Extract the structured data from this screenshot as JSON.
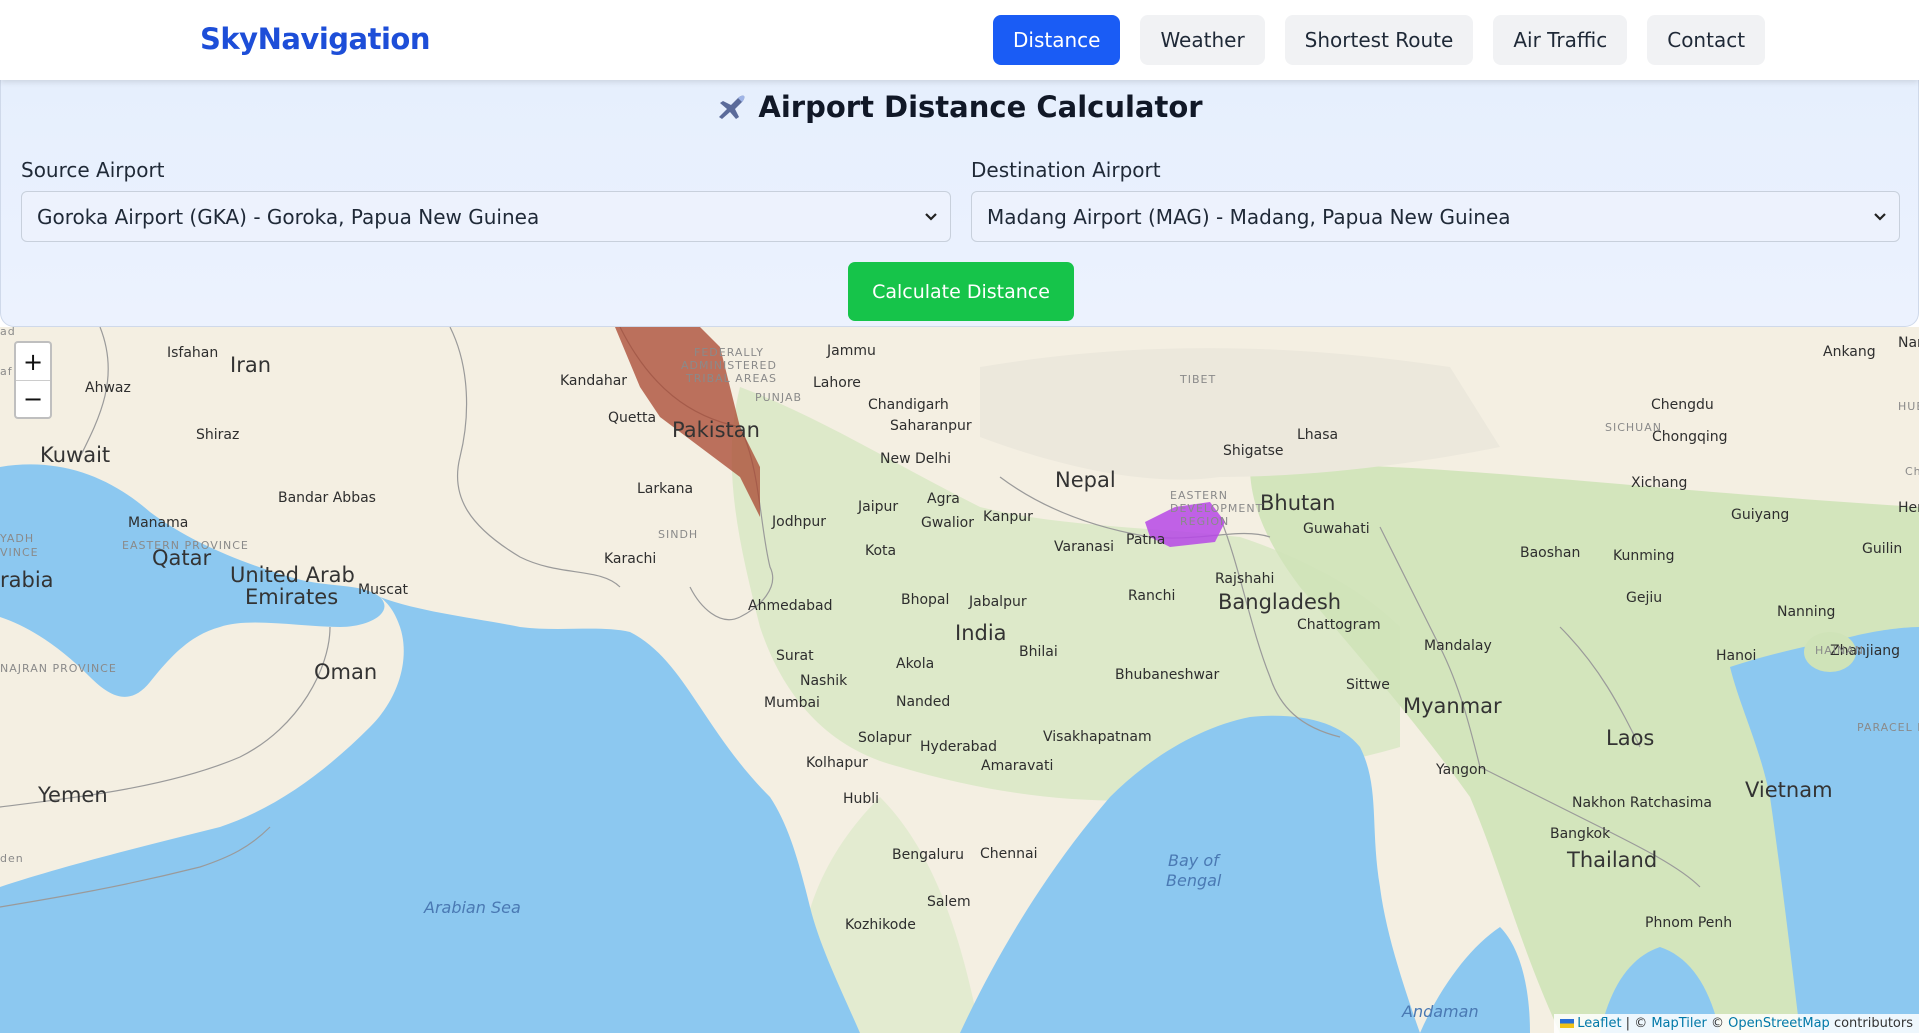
{
  "navbar": {
    "brand": "SkyNavigation",
    "links": [
      {
        "label": "Distance",
        "active": true
      },
      {
        "label": "Weather",
        "active": false
      },
      {
        "label": "Shortest Route",
        "active": false
      },
      {
        "label": "Air Traffic",
        "active": false
      },
      {
        "label": "Contact",
        "active": false
      }
    ]
  },
  "calculator": {
    "title": "Airport Distance Calculator",
    "title_icon": "airplane-icon",
    "source": {
      "label": "Source Airport",
      "value": "Goroka Airport (GKA) - Goroka, Papua New Guinea"
    },
    "destination": {
      "label": "Destination Airport",
      "value": "Madang Airport (MAG) - Madang, Papua New Guinea"
    },
    "button_label": "Calculate Distance"
  },
  "map": {
    "zoom_in": "+",
    "zoom_out": "−",
    "countries": [
      "Iran",
      "Pakistan",
      "Nepal",
      "Bhutan",
      "Bangladesh",
      "India",
      "Myanmar",
      "Laos",
      "Vietnam",
      "Thailand",
      "Oman",
      "Yemen",
      "Kuwait",
      "Qatar",
      "United Arab",
      "Emirates",
      "rabia"
    ],
    "cities": [
      "Isfahan",
      "Ahwaz",
      "Shiraz",
      "Bandar Abbas",
      "Manama",
      "Muscat",
      "Kandahar",
      "Quetta",
      "Jammu",
      "Lahore",
      "Chandigarh",
      "Saharanpur",
      "New Delhi",
      "Larkana",
      "Karachi",
      "Jaipur",
      "Agra",
      "Gwalior",
      "Jodhpur",
      "Kanpur",
      "Varanasi",
      "Patna",
      "Kota",
      "Bhopal",
      "Jabalpur",
      "Ranchi",
      "Ahmedabad",
      "Surat",
      "Nashik",
      "Mumbai",
      "Akola",
      "Bhilai",
      "Nanded",
      "Bhubaneshwar",
      "Solapur",
      "Hyderabad",
      "Visakhapatnam",
      "Kolhapur",
      "Amaravati",
      "Hubli",
      "Bengaluru",
      "Chennai",
      "Salem",
      "Kozhikode",
      "Shigatse",
      "Lhasa",
      "Guwahati",
      "Rajshahi",
      "Chattogram",
      "Sittwe",
      "Mandalay",
      "Yangon",
      "Chengdu",
      "Chongqing",
      "Ankang",
      "Xichang",
      "Guiyang",
      "Baoshan",
      "Kunming",
      "Guilin",
      "Gejiu",
      "Nanning",
      "Zhanjiang",
      "Hanoi",
      "Nakhon Ratchasima",
      "Bangkok",
      "Phnom Penh",
      "Nar",
      "Hen"
    ],
    "regions": [
      "FEDERALLY",
      "ADMINISTERED",
      "TRIBAL AREAS",
      "PUNJAB",
      "SINDH",
      "TIBET",
      "SICHUAN",
      "EASTERN",
      "DEVELOPMENT",
      "REGION",
      "EASTERN PROVINCE",
      "NAJRAN PROVINCE",
      "HAINAN",
      "PARACEL ISLANDS",
      "YADH",
      "VINCE",
      "HUB",
      "Ch",
      "ad",
      "af",
      "den"
    ],
    "seas": [
      "Arabian Sea",
      "Bay of",
      "Bengal",
      "Andaman"
    ],
    "attribution": {
      "leaflet": "Leaflet",
      "sep1": " | © ",
      "maptiler": "MapTiler",
      "sep2": " © ",
      "osm": "OpenStreetMap",
      "tail": " contributors"
    }
  }
}
